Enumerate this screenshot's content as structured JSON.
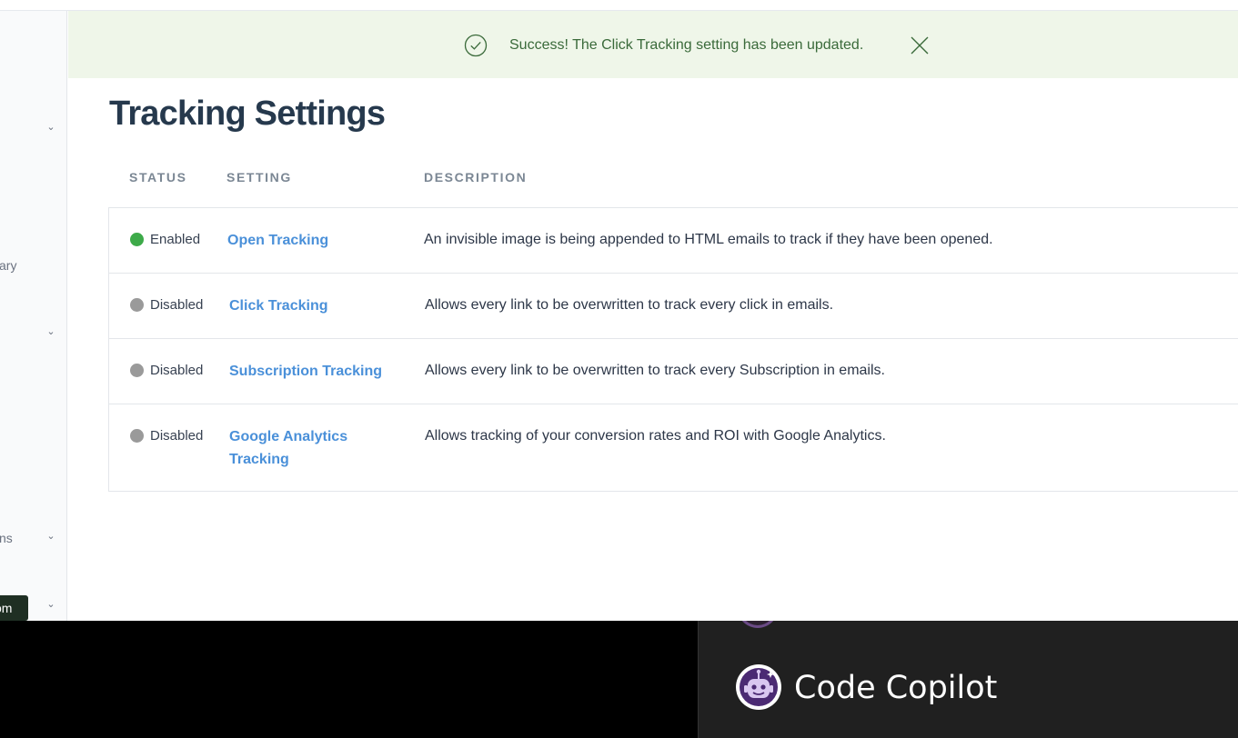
{
  "sidebar": {
    "fragments": [
      "ary",
      "ns"
    ],
    "tooltip": "om"
  },
  "banner": {
    "message": "Success! The Click Tracking setting has been updated.",
    "icon": "check-circle-icon",
    "close_icon": "close-icon",
    "color": "#3a6a3a",
    "background": "#eff6e9"
  },
  "page": {
    "title": "Tracking Settings"
  },
  "table": {
    "headers": [
      "STATUS",
      "SETTING",
      "DESCRIPTION"
    ],
    "rows": [
      {
        "status": "Enabled",
        "status_color": "#3daa49",
        "setting": "Open Tracking",
        "description": "An invisible image is being appended to HTML emails to track if they have been opened."
      },
      {
        "status": "Disabled",
        "status_color": "#9a9a9a",
        "setting": "Click Tracking",
        "description": "Allows every link to be overwritten to track every click in emails."
      },
      {
        "status": "Disabled",
        "status_color": "#9a9a9a",
        "setting": "Subscription Tracking",
        "description": "Allows every link to be overwritten to track every Subscription in emails."
      },
      {
        "status": "Disabled",
        "status_color": "#9a9a9a",
        "setting": "Google Analytics Tracking",
        "description": "Allows tracking of your conversion rates and ROI with Google Analytics."
      }
    ]
  },
  "copilot": {
    "name": "Code Copilot",
    "icon": "robot-avatar-icon"
  },
  "colors": {
    "link": "#4a90d9",
    "title": "#26394d",
    "header": "#7b8794"
  }
}
